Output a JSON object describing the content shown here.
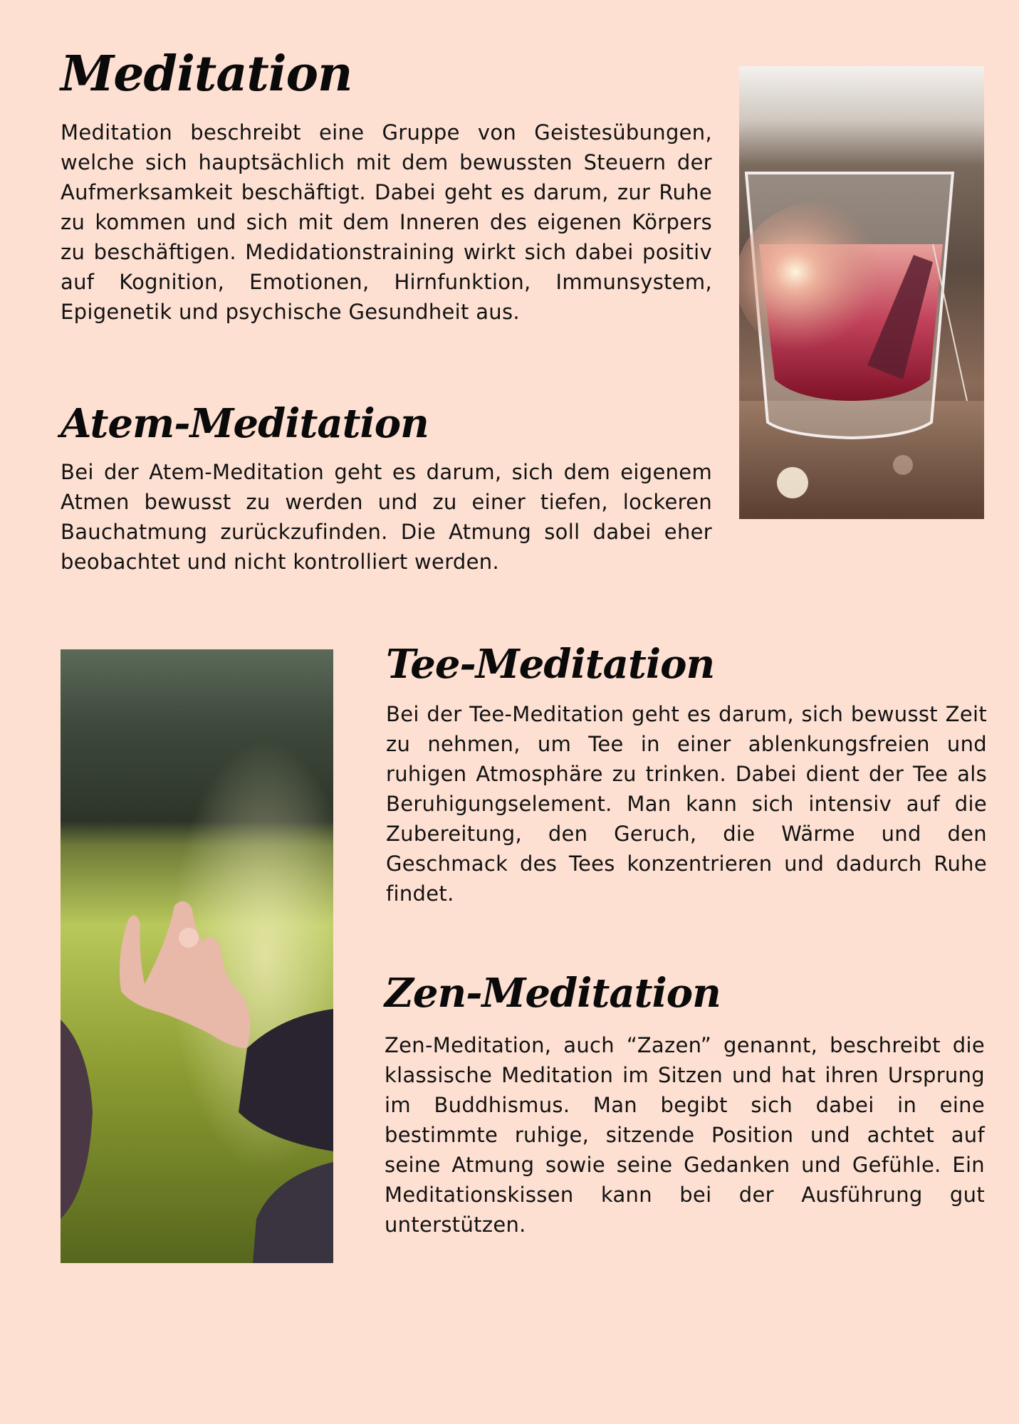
{
  "sections": {
    "meditation": {
      "title": "Meditation",
      "body": "Meditation beschreibt  eine Gruppe von Geistesübungen, welche sich hauptsächlich mit dem bewussten Steuern der Aufmerksamkeit beschäftigt. Dabei geht es darum, zur Ruhe zu kommen und sich mit dem Inneren des eigenen Körpers zu beschäftigen. Medidationstraining wirkt sich dabei positiv auf Kognition, Emotionen, Hirnfunktion, Immunsystem, Epigenetik und psychische Gesundheit aus."
    },
    "atem": {
      "title": "Atem-Meditation",
      "body": "Bei der Atem-Meditation geht es darum,  sich dem eigenem Atmen bewusst zu werden und zu einer tiefen, lockeren Bauchatmung zurückzufinden. Die Atmung soll dabei eher beobachtet und nicht kontrolliert werden."
    },
    "tee": {
      "title": "Tee-Meditation",
      "body": "Bei der Tee-Meditation geht es darum, sich bewusst Zeit zu nehmen, um Tee in einer ablenkungsfreien und ruhigen Atmosphäre zu trinken. Dabei dient der Tee als Beruhigungselement. Man kann sich intensiv auf die Zubereitung, den Geruch, die Wärme und den Geschmack des Tees konzentrieren und dadurch Ruhe findet."
    },
    "zen": {
      "title": "Zen-Meditation",
      "body": "Zen-Meditation, auch “Zazen” genannt, beschreibt die klassische Meditation im Sitzen und hat ihren Ursprung im Buddhismus. Man begibt sich dabei in eine bestimmte ruhige, sitzende Position  und achtet auf seine Atmung sowie seine Gedanken und Gefühle. Ein Meditationskissen kann bei der Ausführung gut unterstützen."
    }
  },
  "colors": {
    "background": "#fde0d2",
    "text": "#111111"
  }
}
